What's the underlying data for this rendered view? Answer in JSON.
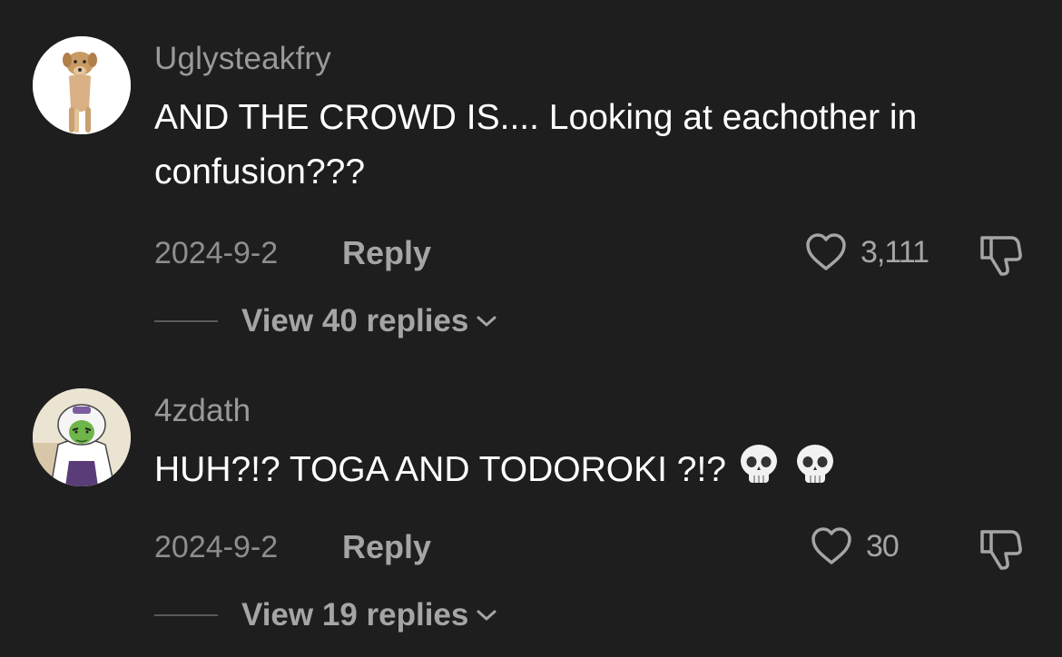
{
  "comments": [
    {
      "username": "Uglysteakfry",
      "text": "AND THE CROWD IS.... Looking at eachother in confusion???",
      "emoji": [],
      "date": "2024-9-2",
      "reply_label": "Reply",
      "likes": "3,111",
      "view_replies": "View 40 replies",
      "avatar": "dog-photo-avatar"
    },
    {
      "username": "4zdath",
      "text": "HUH?!? TOGA AND TODOROKI ?!?",
      "emoji": [
        "skull-emoji",
        "skull-emoji"
      ],
      "date": "2024-9-2",
      "reply_label": "Reply",
      "likes": "30",
      "view_replies": "View 19 replies",
      "avatar": "cartoon-character-avatar"
    }
  ],
  "colors": {
    "background": "#1e1e1e",
    "primary_text": "#ffffff",
    "secondary_text": "#9a9a9a"
  },
  "icons": [
    "heart-outline-icon",
    "thumbs-down-icon",
    "chevron-down-icon"
  ]
}
